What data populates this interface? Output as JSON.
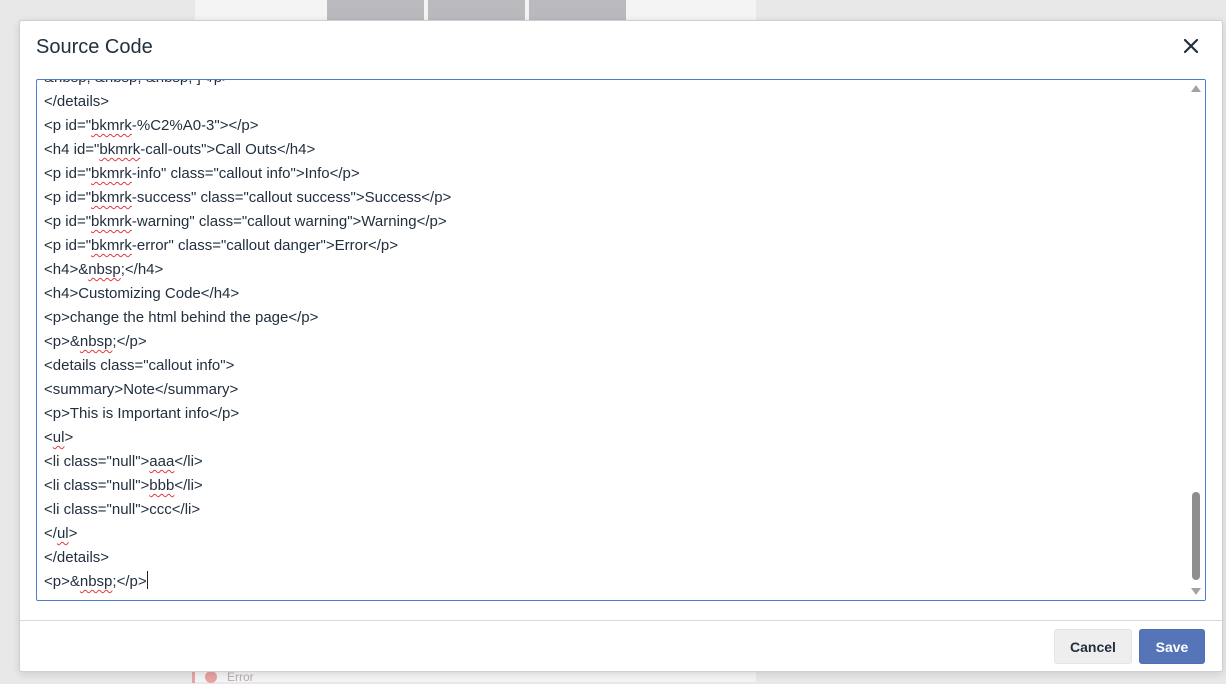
{
  "background": {
    "error_text": "Error"
  },
  "dialog": {
    "title": "Source Code",
    "close_icon": "close-icon",
    "cancel_label": "Cancel",
    "save_label": "Save"
  },
  "editor": {
    "lines": [
      [
        {
          "t": "&nbsp; &nbsp; &nbsp; ]</p>"
        }
      ],
      [
        {
          "t": "</details>"
        }
      ],
      [
        {
          "t": "<p id=\""
        },
        {
          "t": "bkmrk",
          "s": true
        },
        {
          "t": "-%C2%A0-3\"></p>"
        }
      ],
      [
        {
          "t": "<h4 id=\""
        },
        {
          "t": "bkmrk",
          "s": true
        },
        {
          "t": "-call-outs\">Call Outs</h4>"
        }
      ],
      [
        {
          "t": "<p id=\""
        },
        {
          "t": "bkmrk",
          "s": true
        },
        {
          "t": "-info\" class=\"callout info\">Info</p>"
        }
      ],
      [
        {
          "t": "<p id=\""
        },
        {
          "t": "bkmrk",
          "s": true
        },
        {
          "t": "-success\" class=\"callout success\">Success</p>"
        }
      ],
      [
        {
          "t": "<p id=\""
        },
        {
          "t": "bkmrk",
          "s": true
        },
        {
          "t": "-warning\" class=\"callout warning\">Warning</p>"
        }
      ],
      [
        {
          "t": "<p id=\""
        },
        {
          "t": "bkmrk",
          "s": true
        },
        {
          "t": "-error\" class=\"callout danger\">Error</p>"
        }
      ],
      [
        {
          "t": "<h4>&"
        },
        {
          "t": "nbsp",
          "s": true
        },
        {
          "t": ";</h4>"
        }
      ],
      [
        {
          "t": "<h4>Customizing Code</h4>"
        }
      ],
      [
        {
          "t": "<p>change the html behind the page</p>"
        }
      ],
      [
        {
          "t": "<p>&"
        },
        {
          "t": "nbsp",
          "s": true
        },
        {
          "t": ";</p>"
        }
      ],
      [
        {
          "t": "<details class=\"callout info\">"
        }
      ],
      [
        {
          "t": "<summary>Note</summary>"
        }
      ],
      [
        {
          "t": "<p>This is Important info</p>"
        }
      ],
      [
        {
          "t": "<"
        },
        {
          "t": "ul",
          "s": true
        },
        {
          "t": ">"
        }
      ],
      [
        {
          "t": "<li class=\"null\">"
        },
        {
          "t": "aaa",
          "s": true
        },
        {
          "t": "</li>"
        }
      ],
      [
        {
          "t": "<li class=\"null\">"
        },
        {
          "t": "bbb",
          "s": true
        },
        {
          "t": "</li>"
        }
      ],
      [
        {
          "t": "<li class=\"null\">ccc</li>"
        }
      ],
      [
        {
          "t": "</"
        },
        {
          "t": "ul",
          "s": true
        },
        {
          "t": ">"
        }
      ],
      [
        {
          "t": "</details>"
        }
      ],
      [
        {
          "t": "<p>&"
        },
        {
          "t": "nbsp",
          "s": true
        },
        {
          "t": ";</p>"
        }
      ]
    ]
  }
}
